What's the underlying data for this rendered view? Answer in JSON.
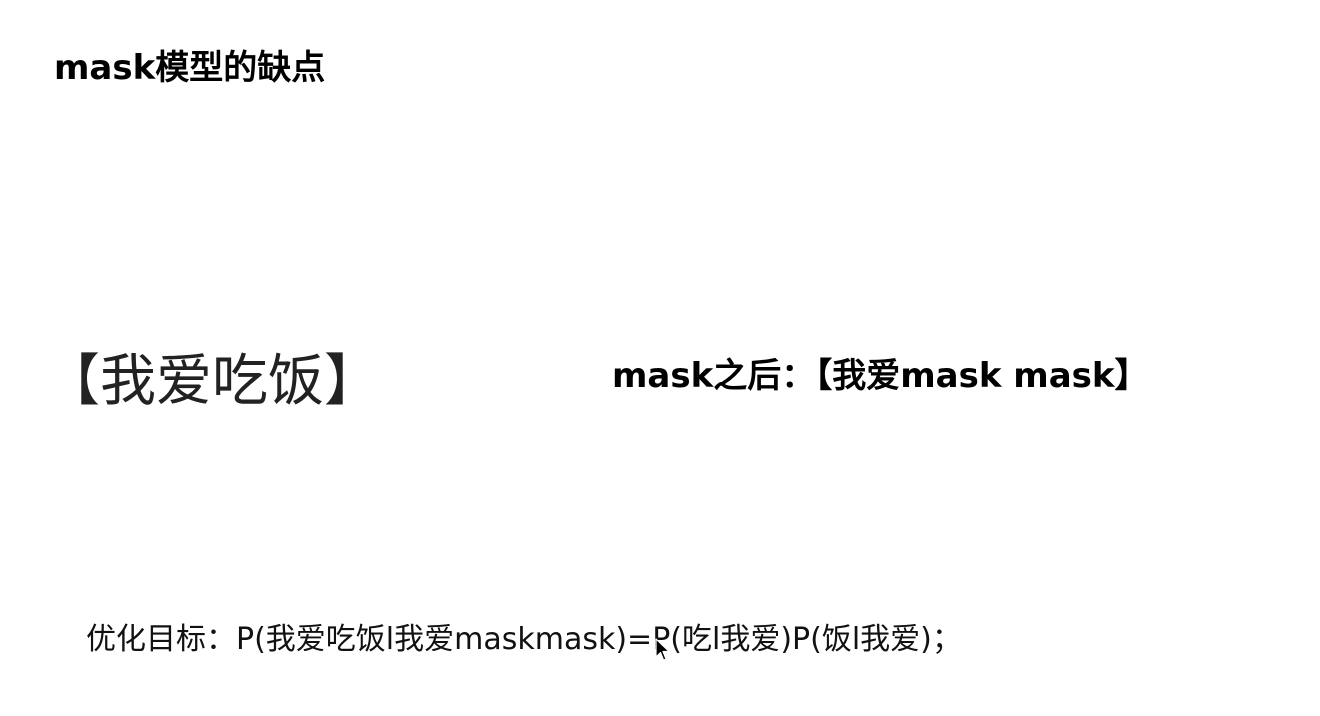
{
  "slide": {
    "title": "mask模型的缺点",
    "example_sentence": "【我爱吃饭】",
    "after_mask": "mask之后：【我爱mask mask】",
    "objective": "优化目标：P(我爱吃饭l我爱maskmask)=P(吃l我爱)P(饭l我爱)；"
  },
  "icons": {
    "cursor": "mouse-pointer-icon"
  }
}
